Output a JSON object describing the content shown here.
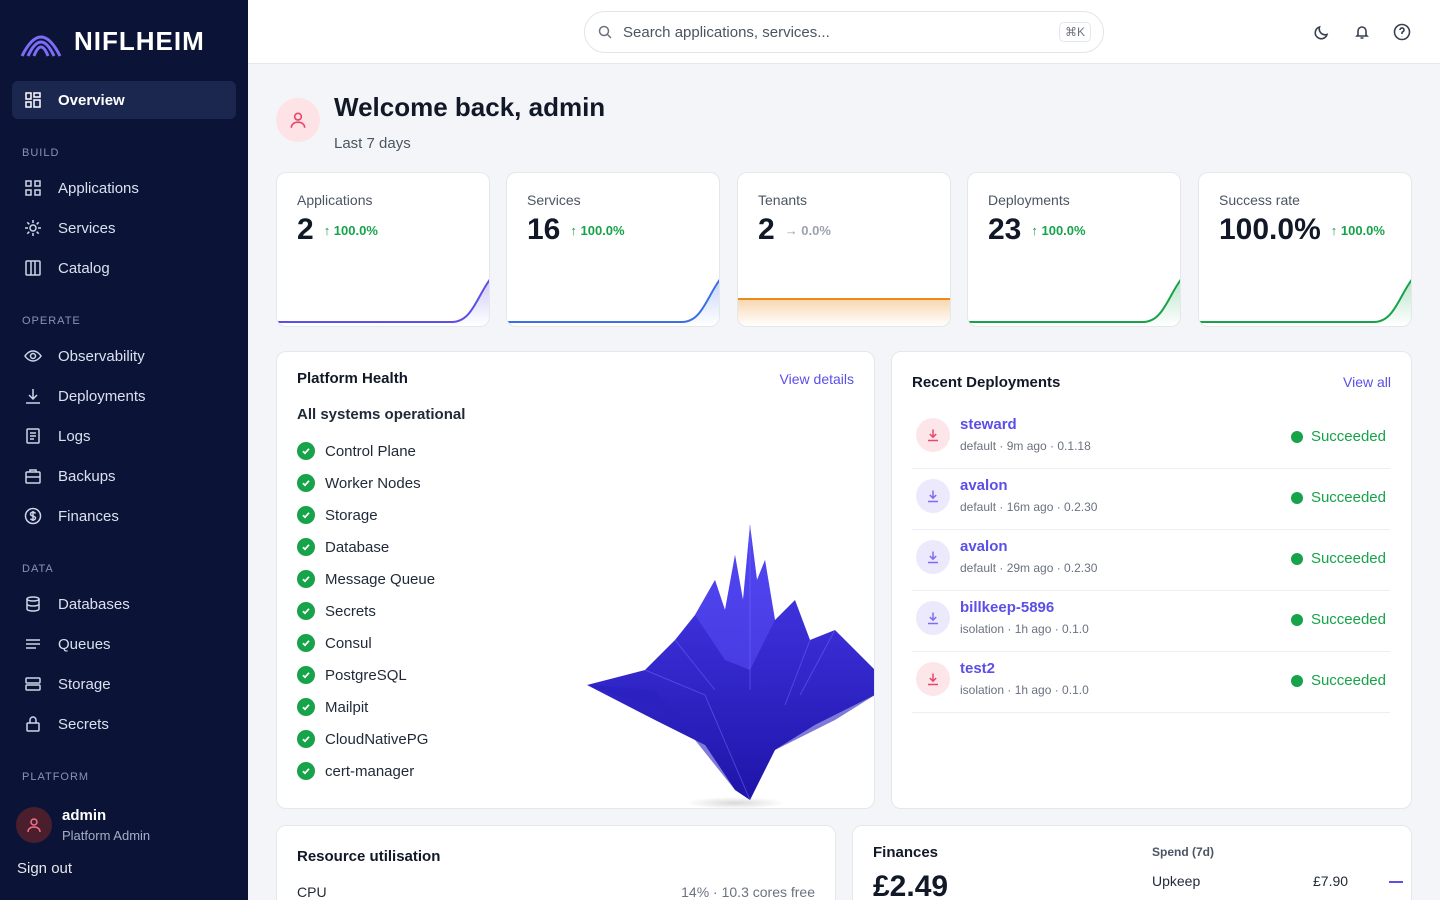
{
  "brand": {
    "name": "NIFLHEIM"
  },
  "sidebar": {
    "active": {
      "label": "Overview",
      "icon": "grid-icon"
    },
    "sections": [
      {
        "title": "BUILD",
        "items": [
          {
            "label": "Applications",
            "icon": "apps-icon"
          },
          {
            "label": "Services",
            "icon": "sun-icon"
          },
          {
            "label": "Catalog",
            "icon": "book-icon"
          }
        ]
      },
      {
        "title": "OPERATE",
        "items": [
          {
            "label": "Observability",
            "icon": "eye-icon"
          },
          {
            "label": "Deployments",
            "icon": "download-icon"
          },
          {
            "label": "Logs",
            "icon": "document-icon"
          },
          {
            "label": "Backups",
            "icon": "briefcase-icon"
          },
          {
            "label": "Finances",
            "icon": "dollar-icon"
          }
        ]
      },
      {
        "title": "DATA",
        "items": [
          {
            "label": "Databases",
            "icon": "database-icon"
          },
          {
            "label": "Queues",
            "icon": "list-icon"
          },
          {
            "label": "Storage",
            "icon": "server-icon"
          },
          {
            "label": "Secrets",
            "icon": "lock-icon"
          }
        ]
      },
      {
        "title": "PLATFORM",
        "items": []
      }
    ],
    "user": {
      "name": "admin",
      "role": "Platform Admin"
    },
    "sign_out": "Sign out"
  },
  "topbar": {
    "search_placeholder": "Search applications, services...",
    "shortcut": "⌘K"
  },
  "welcome": {
    "title": "Welcome back, admin",
    "subtitle": "Last 7 days"
  },
  "kpis": [
    {
      "label": "Applications",
      "value": "2",
      "delta": "↑ 100.0%",
      "color": "#5b4fe8"
    },
    {
      "label": "Services",
      "value": "16",
      "delta": "↑ 100.0%",
      "color": "#3b6fe8"
    },
    {
      "label": "Tenants",
      "value": "2",
      "delta": "→ 0.0%",
      "color": "#ea8a1a"
    },
    {
      "label": "Deployments",
      "value": "23",
      "delta": "↑ 100.0%",
      "color": "#16a34a"
    },
    {
      "label": "Success rate",
      "value": "100.0%",
      "delta": "↑ 100.0%",
      "color": "#16a34a"
    }
  ],
  "health": {
    "title": "Platform Health",
    "link": "View details",
    "status": "All systems operational",
    "items": [
      "Control Plane",
      "Worker Nodes",
      "Storage",
      "Database",
      "Message Queue",
      "Secrets",
      "Consul",
      "PostgreSQL",
      "Mailpit",
      "CloudNativePG",
      "cert-manager"
    ]
  },
  "deployments": {
    "title": "Recent Deployments",
    "link": "View all",
    "items": [
      {
        "name": "steward",
        "meta": "default · 9m ago · 0.1.18",
        "status": "Succeeded",
        "tone": "pink"
      },
      {
        "name": "avalon",
        "meta": "default · 16m ago · 0.2.30",
        "status": "Succeeded",
        "tone": "purple"
      },
      {
        "name": "avalon",
        "meta": "default · 29m ago · 0.2.30",
        "status": "Succeeded",
        "tone": "purple"
      },
      {
        "name": "billkeep-5896",
        "meta": "isolation · 1h ago · 0.1.0",
        "status": "Succeeded",
        "tone": "purple"
      },
      {
        "name": "test2",
        "meta": "isolation · 1h ago · 0.1.0",
        "status": "Succeeded",
        "tone": "pink"
      }
    ]
  },
  "resources": {
    "title": "Resource utilisation",
    "cpu_label": "CPU",
    "cpu_value": "14% · 10.3 cores free"
  },
  "finances": {
    "title": "Finances",
    "total": "£2.49",
    "spend_label": "Spend (7d)",
    "upkeep_label": "Upkeep",
    "upkeep_value": "£7.90"
  }
}
